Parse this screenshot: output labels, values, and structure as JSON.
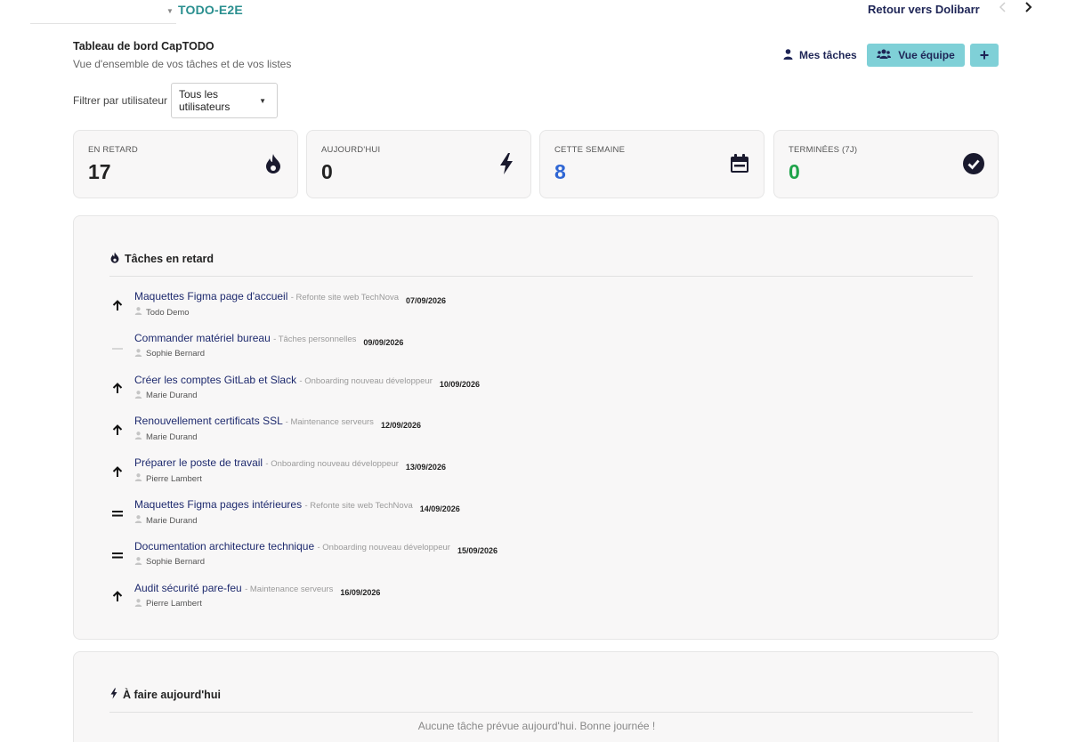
{
  "topbar": {
    "project": "TODO-E2E",
    "back_link": "Retour vers Dolibarr",
    "prev": "‹",
    "next": "›"
  },
  "header": {
    "title": "Tableau de bord CapTODO",
    "subtitle": "Vue d'ensemble de vos tâches et de vos listes",
    "my_tasks": "Mes tâches",
    "team_view": "Vue équipe",
    "add": "+"
  },
  "filter": {
    "label": "Filtrer par utilisateur",
    "selected": "Tous les utilisateurs"
  },
  "stats": [
    {
      "label": "EN RETARD",
      "value": "17",
      "color": "#222222",
      "icon": "fire-icon"
    },
    {
      "label": "AUJOURD'HUI",
      "value": "0",
      "color": "#222222",
      "icon": "bolt-icon"
    },
    {
      "label": "CETTE SEMAINE",
      "value": "8",
      "color": "#2f66d4",
      "icon": "calendar-icon"
    },
    {
      "label": "TERMINÉES (7J)",
      "value": "0",
      "color": "#1fa34a",
      "icon": "check-circle-icon"
    }
  ],
  "overdue": {
    "title": "Tâches en retard",
    "tasks": [
      {
        "title": "Maquettes Figma page d'accueil",
        "project": "- Refonte site web TechNova",
        "date": "07/09/2026",
        "user": "Todo Demo",
        "priority": "high"
      },
      {
        "title": "Commander matériel bureau",
        "project": "- Tâches personnelles",
        "date": "09/09/2026",
        "user": "Sophie Bernard",
        "priority": "low"
      },
      {
        "title": "Créer les comptes GitLab et Slack",
        "project": "- Onboarding nouveau développeur",
        "date": "10/09/2026",
        "user": "Marie Durand",
        "priority": "high"
      },
      {
        "title": "Renouvellement certificats SSL",
        "project": "- Maintenance serveurs",
        "date": "12/09/2026",
        "user": "Marie Durand",
        "priority": "high"
      },
      {
        "title": "Préparer le poste de travail",
        "project": "- Onboarding nouveau développeur",
        "date": "13/09/2026",
        "user": "Pierre Lambert",
        "priority": "high"
      },
      {
        "title": "Maquettes Figma pages intérieures",
        "project": "- Refonte site web TechNova",
        "date": "14/09/2026",
        "user": "Marie Durand",
        "priority": "normal"
      },
      {
        "title": "Documentation architecture technique",
        "project": "- Onboarding nouveau développeur",
        "date": "15/09/2026",
        "user": "Sophie Bernard",
        "priority": "normal"
      },
      {
        "title": "Audit sécurité pare-feu",
        "project": "- Maintenance serveurs",
        "date": "16/09/2026",
        "user": "Pierre Lambert",
        "priority": "high"
      }
    ]
  },
  "today": {
    "title": "À faire aujourd'hui",
    "empty": "Aucune tâche prévue aujourd'hui. Bonne journée !"
  }
}
